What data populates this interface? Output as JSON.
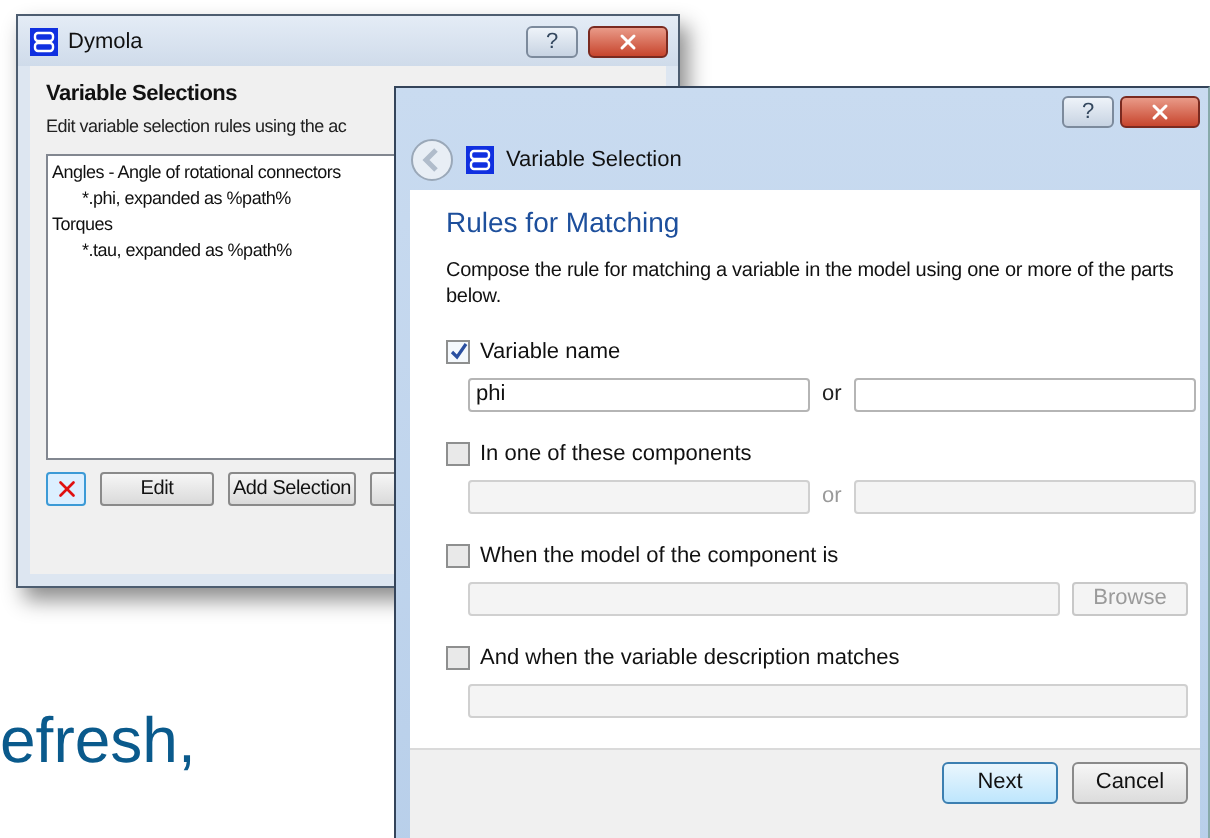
{
  "background_text": "efresh,",
  "back_window": {
    "title": "Dymola",
    "help": "?",
    "heading": "Variable Selections",
    "description": "Edit variable selection rules using the ac",
    "rules": [
      {
        "text": "Angles - Angle of rotational connectors",
        "children": [
          {
            "text": "*.phi, expanded as %path%"
          }
        ]
      },
      {
        "text": "Torques",
        "children": [
          {
            "text": "*.tau, expanded as %path%"
          }
        ]
      }
    ],
    "buttons": [
      {
        "kind": "delete"
      },
      {
        "kind": "text",
        "label": "Edit"
      },
      {
        "kind": "text",
        "label": "Add Selection"
      },
      {
        "kind": "plain"
      }
    ]
  },
  "dialog": {
    "title": "Variable Selection",
    "help": "?",
    "heading": "Rules for Matching",
    "description": "Compose the rule for matching a variable in the model using one or more of the parts below.",
    "criteria": [
      {
        "label": "Variable name",
        "checked": true,
        "separator": "or",
        "fields": [
          {
            "kind": "text",
            "value": "phi"
          },
          {
            "kind": "text"
          }
        ]
      },
      {
        "label": "In one of these components",
        "checked": false,
        "separator": "or",
        "fields": [
          {
            "kind": "text"
          },
          {
            "kind": "text"
          }
        ]
      },
      {
        "label": "When the model of the component is",
        "checked": false,
        "fields": [
          {
            "kind": "text"
          },
          {
            "kind": "button",
            "label": "Browse"
          }
        ]
      },
      {
        "label": "And when the variable description matches",
        "checked": false,
        "fields": [
          {
            "kind": "text"
          }
        ]
      }
    ],
    "buttons": [
      {
        "label": "Next",
        "default": true
      },
      {
        "label": "Cancel",
        "default": false
      }
    ]
  }
}
